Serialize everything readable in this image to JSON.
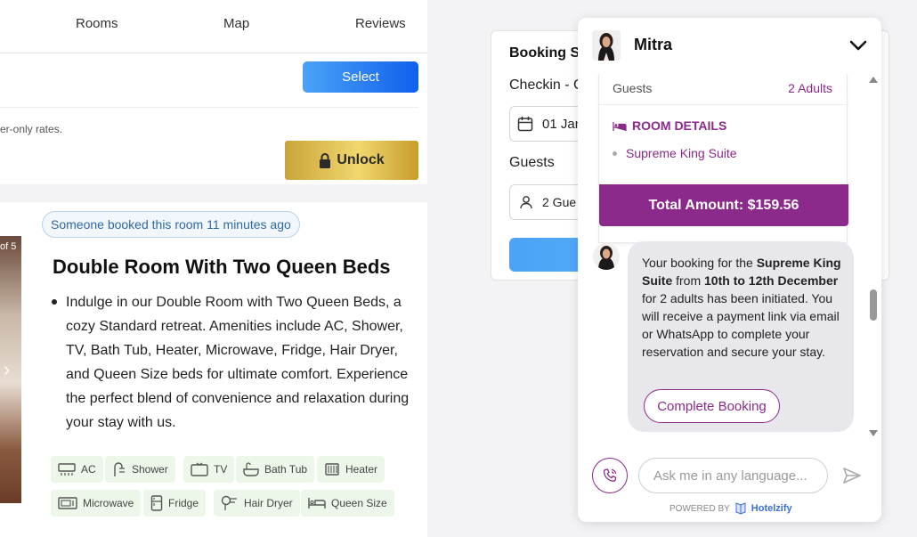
{
  "tabs": [
    "Rooms",
    "Map",
    "Reviews"
  ],
  "rate_card": {
    "select_label": "Select",
    "member_text": "er-only rates.",
    "unlock_label": "Unlock"
  },
  "room": {
    "photo_counter": "of 5",
    "booked_badge": "Someone booked this room 11 minutes ago",
    "title": "Double Room With Two Queen Beds",
    "description": "Indulge in our Double Room with Two Queen Beds, a cozy Standard retreat. Amenities include AC, Shower, TV, Bath Tub, Heater, Microwave, Fridge, Hair Dryer, and Queen Size beds for ultimate comfort. Experience the perfect blend of convenience and relaxation during your stay with us.",
    "amenities": [
      "AC",
      "Shower",
      "TV",
      "Bath Tub",
      "Heater",
      "Microwave",
      "Fridge",
      "Hair Dryer",
      "Queen Size"
    ]
  },
  "booking_card": {
    "title": "Booking S",
    "checkin_label": "Checkin - C",
    "date_value": "01 Jan",
    "guests_label": "Guests",
    "guests_value": "2 Gue"
  },
  "chat": {
    "agent_name": "Mitra",
    "summary": {
      "guests_label": "Guests",
      "guests_value": "2 Adults",
      "room_details_label": "ROOM DETAILS",
      "room_item": "Supreme King Suite",
      "total_label": "Total Amount: $159.56"
    },
    "bot_message": {
      "part1": "Your booking for the ",
      "bold1": "Supreme King Suite",
      "part2": " from ",
      "bold2": "10th to 12th December",
      "part3": " for 2 adults has been initiated. You will receive a payment link via email or WhatsApp to complete your reservation and secure your stay."
    },
    "complete_label": "Complete Booking",
    "input_placeholder": "Ask me in any language...",
    "powered_by": "POWERED BY",
    "brand": "Hotelzify"
  },
  "colors": {
    "brand_purple": "#8b2a8b",
    "select_blue": "#1060ec",
    "unlock_gold": "#d4b24a",
    "amenity_bg": "#ecf7ea"
  }
}
